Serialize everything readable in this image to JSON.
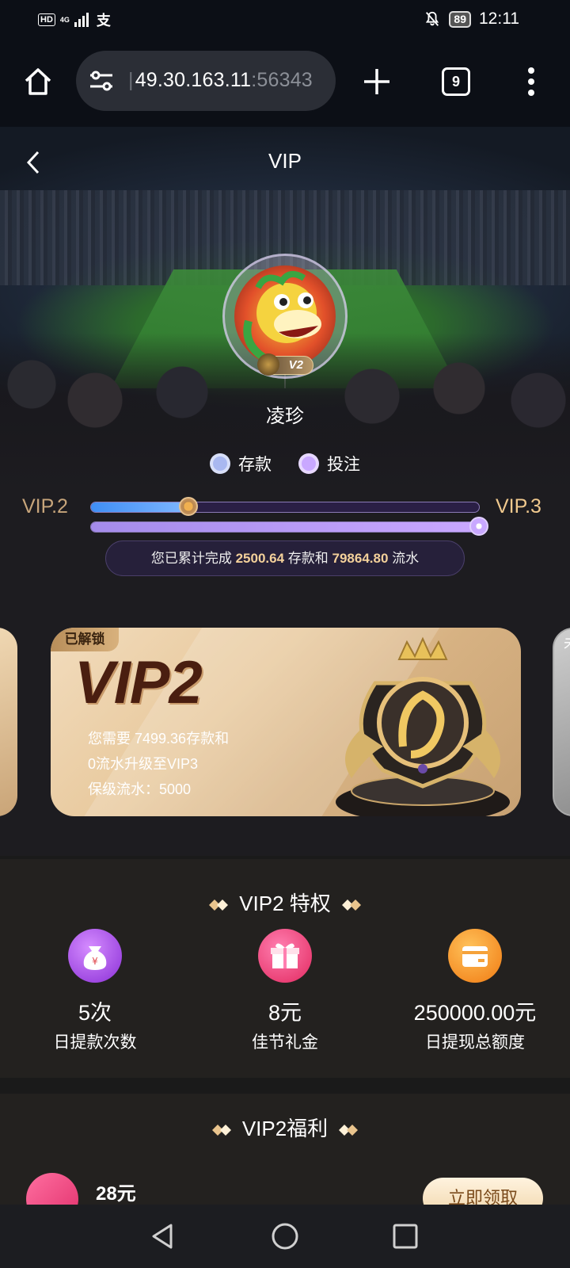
{
  "status_bar": {
    "hd": "HD",
    "network": "4G",
    "app_icon": "支",
    "battery": "89",
    "time": "12:11"
  },
  "browser": {
    "url_host": "49.30.163.11",
    "url_port": ":56343",
    "tab_count": "9"
  },
  "page": {
    "title": "VIP"
  },
  "profile": {
    "username": "凌珍",
    "vip_badge": "V2"
  },
  "legend": {
    "deposit": "存款",
    "bet": "投注",
    "deposit_color": "#a9b8f0",
    "bet_color": "#c9a8ff"
  },
  "progress": {
    "current_level": "VIP.2",
    "next_level": "VIP.3",
    "deposit_fraction": 0.25,
    "bet_fraction": 1.0,
    "summary_prefix": "您已累计完成",
    "deposit_total": "2500.64",
    "summary_middle": "存款和",
    "turnover_total": "79864.80",
    "summary_suffix": "流水"
  },
  "card": {
    "tag": "已解锁",
    "title": "VIP2",
    "line1": "您需要  7499.36存款和",
    "line2": "0流水升级至VIP3",
    "line3": "保级流水：5000",
    "next_card_tag": "未"
  },
  "privileges": {
    "title": "VIP2 特权",
    "items": [
      {
        "value": "5次",
        "label": "日提款次数",
        "icon": "money-bag-icon"
      },
      {
        "value": "8元",
        "label": "佳节礼金",
        "icon": "gift-icon"
      },
      {
        "value": "250000.00元",
        "label": "日提现总额度",
        "icon": "wallet-icon"
      }
    ]
  },
  "benefits": {
    "title": "VIP2福利",
    "item_amount": "28元",
    "claim_label": "立即领取"
  },
  "colors": {
    "accent_gold": "#f0c98e",
    "deposit_bar": "#5aa0ff",
    "bet_bar": "#c9a8ff"
  }
}
